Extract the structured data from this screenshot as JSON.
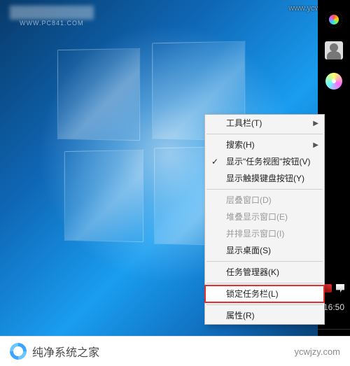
{
  "topleft": {
    "subtext": "WWW.PC841.COM"
  },
  "watermark_tr": "www.ycwjzy.com",
  "taskbar": {
    "right": true,
    "clock": "16:50",
    "date": ""
  },
  "context_menu": {
    "items": [
      {
        "key": "toolbars",
        "label": "工具栏(T)",
        "submenu": true
      },
      {
        "sep": true
      },
      {
        "key": "search",
        "label": "搜索(H)",
        "submenu": true
      },
      {
        "key": "taskview",
        "label": "显示\"任务视图\"按钮(V)",
        "checked": true
      },
      {
        "key": "touchkb",
        "label": "显示触摸键盘按钮(Y)"
      },
      {
        "sep": true
      },
      {
        "key": "cascade",
        "label": "层叠窗口(D)",
        "disabled": true
      },
      {
        "key": "stacked",
        "label": "堆叠显示窗口(E)",
        "disabled": true
      },
      {
        "key": "sidebyside",
        "label": "并排显示窗口(I)",
        "disabled": true
      },
      {
        "key": "showdesktop",
        "label": "显示桌面(S)"
      },
      {
        "sep": true
      },
      {
        "key": "taskmgr",
        "label": "任务管理器(K)"
      },
      {
        "sep": true
      },
      {
        "key": "lock",
        "label": "锁定任务栏(L)",
        "highlight": true
      },
      {
        "sep": true
      },
      {
        "key": "properties",
        "label": "属性(R)"
      }
    ]
  },
  "bottom_brand": {
    "name": "纯净系统之家",
    "site": "ycwjzy.com"
  }
}
